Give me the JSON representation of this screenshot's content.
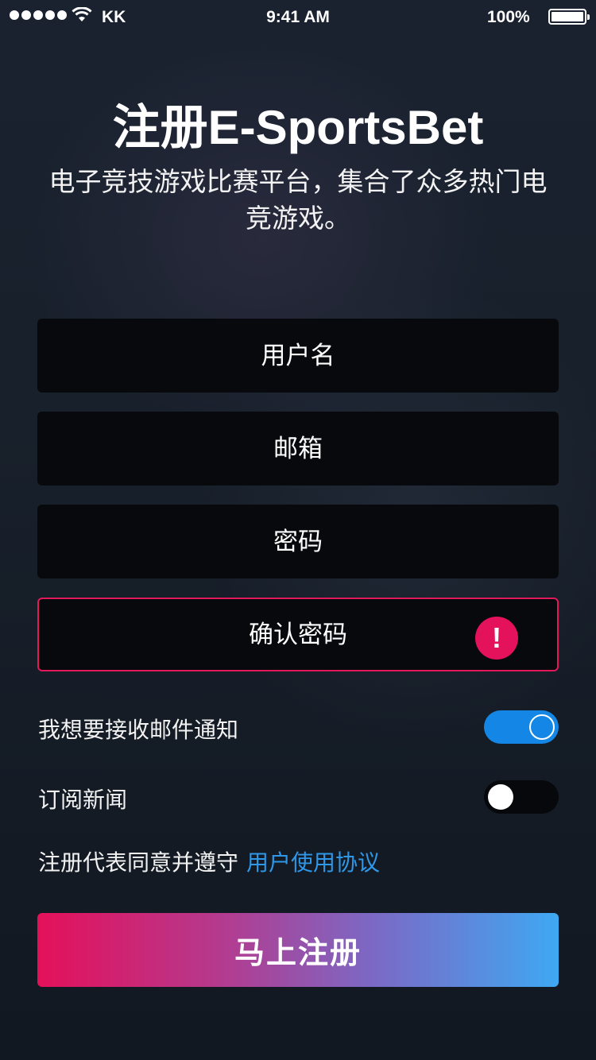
{
  "status_bar": {
    "carrier": "KK",
    "time": "9:41 AM",
    "battery": "100%"
  },
  "header": {
    "title": "注册E-SportsBet",
    "subtitle": "电子竞技游戏比赛平台，集合了众多热门电竞游戏。"
  },
  "form": {
    "username_placeholder": "用户名",
    "email_placeholder": "邮箱",
    "password_placeholder": "密码",
    "confirm_password_placeholder": "确认密码",
    "confirm_error_icon": "!"
  },
  "options": {
    "email_notify_label": "我想要接收邮件通知",
    "email_notify_on": true,
    "newsletter_label": "订阅新闻",
    "newsletter_on": false
  },
  "agreement": {
    "text": "注册代表同意并遵守",
    "link": "用户使用协议"
  },
  "submit_label": "马上注册",
  "colors": {
    "accent_blue": "#1487e6",
    "error_red": "#e3125a",
    "link_blue": "#2f97e8"
  }
}
